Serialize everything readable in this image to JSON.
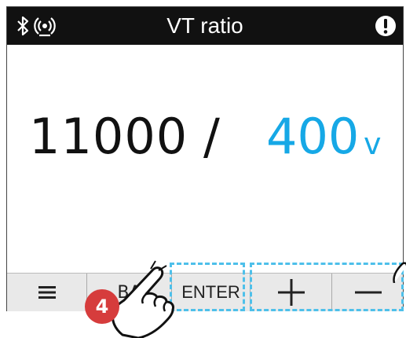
{
  "header": {
    "title": "VT ratio",
    "icons": [
      "bluetooth-icon",
      "wireless-signal-icon",
      "alert-icon"
    ]
  },
  "readout": {
    "primary": "11000",
    "separator": "/",
    "secondary": "400",
    "unit": "v"
  },
  "softkeys": {
    "menu": "menu-icon",
    "back_label": "BA",
    "enter_label": "ENTER",
    "plus": "plus-icon",
    "minus": "minus-icon"
  },
  "annotation": {
    "step_number": "4"
  },
  "colors": {
    "accent": "#16a8e6",
    "badge": "#d63c3c",
    "highlight": "#4ec0ea",
    "header_bg": "#111111"
  }
}
